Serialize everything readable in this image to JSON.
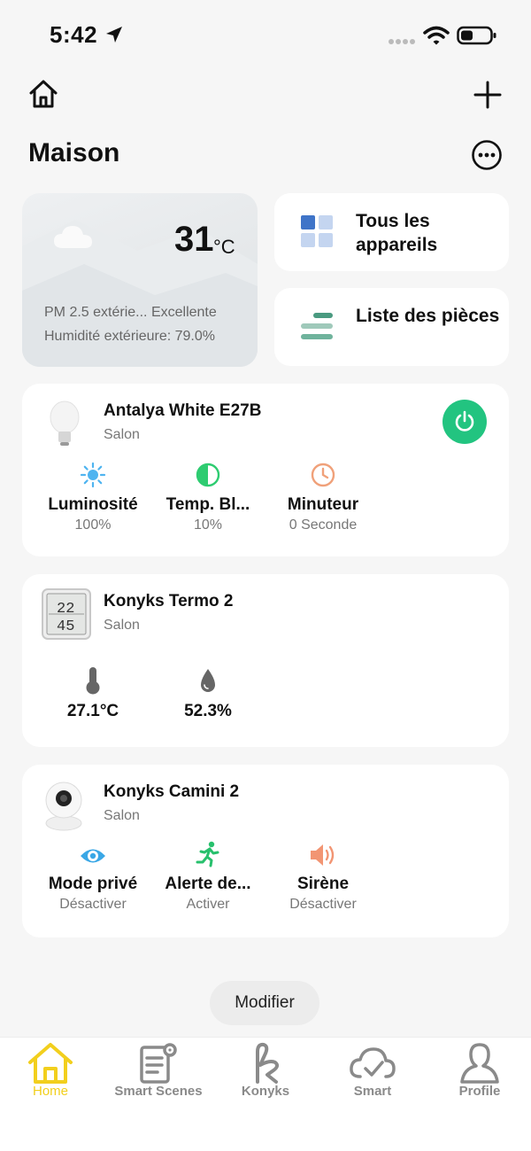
{
  "status_bar": {
    "time": "5:42"
  },
  "header": {
    "title": "Maison"
  },
  "weather": {
    "temperature": "31",
    "unit": "°C",
    "pm_text": "PM 2.5 extérie... Excellente",
    "humidity_text": "Humidité extérieure: 79.0%"
  },
  "quick": {
    "all_devices": "Tous les appareils",
    "room_list": "Liste des pièces"
  },
  "devices": [
    {
      "name": "Antalya White E27B",
      "room": "Salon",
      "controls": [
        {
          "icon": "sun-icon",
          "title": "Luminosité",
          "value": "100%"
        },
        {
          "icon": "half-circle-icon",
          "title": "Temp. Bl...",
          "value": "10%"
        },
        {
          "icon": "clock-icon",
          "title": "Minuteur",
          "value": "0 Seconde"
        }
      ]
    },
    {
      "name": "Konyks Termo 2",
      "room": "Salon",
      "controls": [
        {
          "icon": "thermometer-icon",
          "title": "27.1°C"
        },
        {
          "icon": "droplet-icon",
          "title": "52.3%"
        }
      ]
    },
    {
      "name": "Konyks Camini 2",
      "room": "Salon",
      "controls": [
        {
          "icon": "eye-icon",
          "title": "Mode privé",
          "value": "Désactiver"
        },
        {
          "icon": "running-person-icon",
          "title": "Alerte de...",
          "value": "Activer"
        },
        {
          "icon": "speaker-icon",
          "title": "Sirène",
          "value": "Désactiver"
        }
      ]
    }
  ],
  "modify_label": "Modifier",
  "tabs": [
    {
      "label": "Home",
      "active": true
    },
    {
      "label": "Smart Scenes"
    },
    {
      "label": "Konyks"
    },
    {
      "label": "Smart"
    },
    {
      "label": "Profile"
    }
  ],
  "colors": {
    "accent_green": "#22c480",
    "tab_active": "#f2cf1d",
    "sun_blue": "#4fb4f0",
    "temp_green": "#2ecc71",
    "timer_orange": "#f0a17a",
    "eye_blue": "#3aa7e6",
    "motion_green": "#27c06c",
    "siren_orange": "#f29573"
  }
}
